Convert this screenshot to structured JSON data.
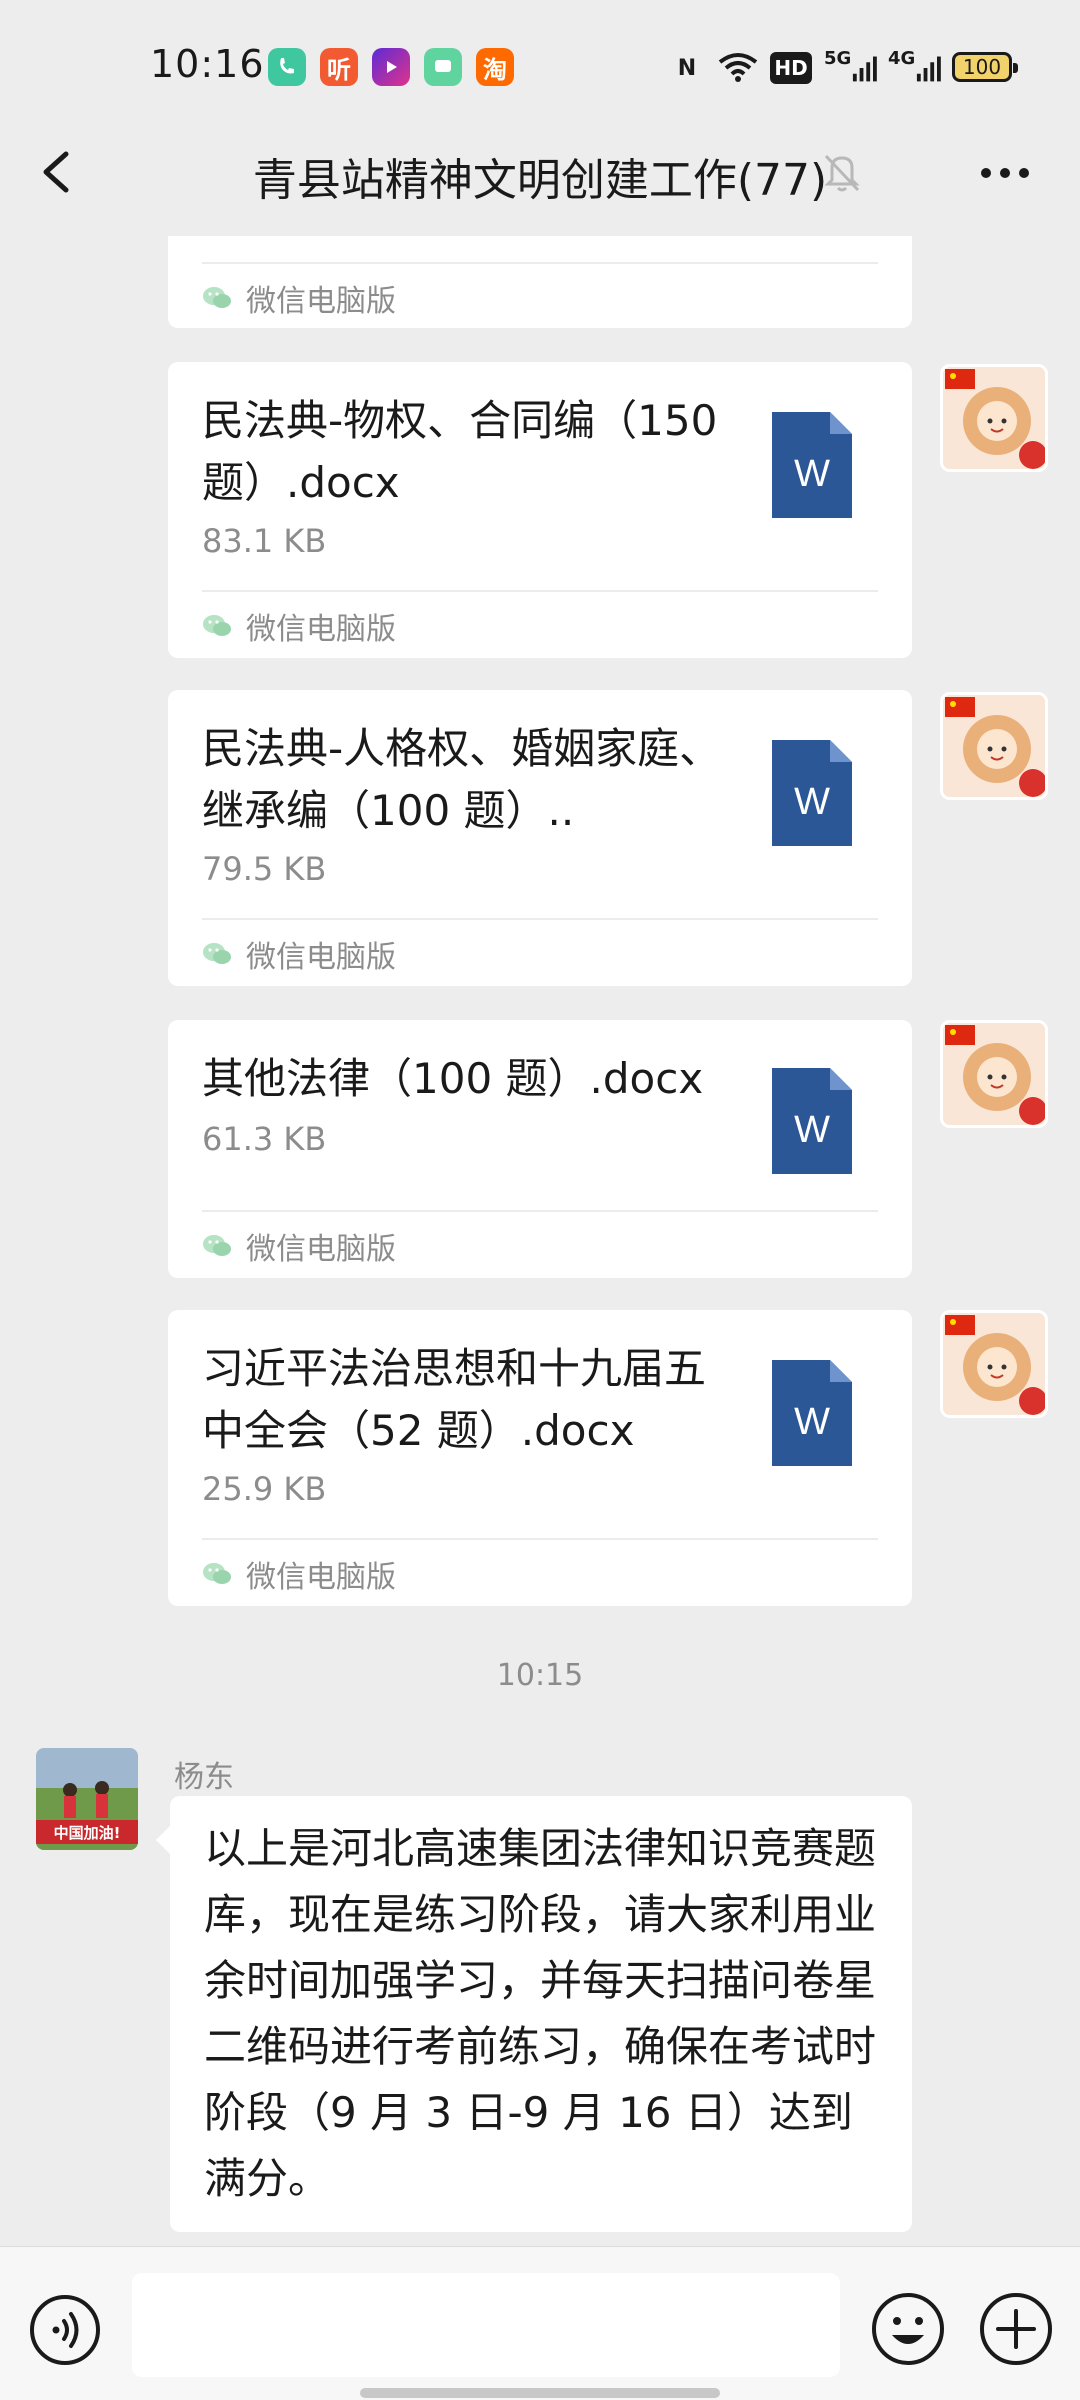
{
  "status_bar": {
    "time": "10:16",
    "app_icons": [
      "phone-app-icon",
      "ximalaya-app-icon",
      "video-app-icon",
      "message-app-icon",
      "taobao-app-icon"
    ],
    "ximalaya_glyph": "听",
    "taobao_glyph": "淘",
    "nfc_glyph": "N",
    "hd_label": "HD",
    "network_5g": "5G",
    "network_4g": "4G",
    "battery": "100"
  },
  "header": {
    "title": "青县站精神文明创建工作(77)"
  },
  "messages": {
    "partial": {
      "source": "微信电脑版"
    },
    "files": [
      {
        "name": "民法典-物权、合同编（150 题）.docx",
        "size": "83.1 KB",
        "source": "微信电脑版",
        "icon_letter": "W"
      },
      {
        "name": "民法典-人格权、婚姻家庭、继承编（100 题）..",
        "size": "79.5 KB",
        "source": "微信电脑版",
        "icon_letter": "W"
      },
      {
        "name": "其他法律（100 题）.docx",
        "size": "61.3 KB",
        "source": "微信电脑版",
        "icon_letter": "W"
      },
      {
        "name": "习近平法治思想和十九届五中全会（52 题）.docx",
        "size": "25.9 KB",
        "source": "微信电脑版",
        "icon_letter": "W"
      }
    ],
    "timestamp": "10:15",
    "text_message": {
      "sender": "杨东",
      "avatar_caption": "中国加油!",
      "text": "以上是河北高速集团法律知识竞赛题库，现在是练习阶段，请大家利用业余时间加强学习，并每天扫描问卷星二维码进行考前练习，确保在考试时阶段（9 月 3 日-9 月 16 日）达到满分。"
    }
  },
  "colors": {
    "background": "#ededed",
    "bubble": "#ffffff",
    "word_blue": "#2b5796",
    "secondary_text": "#8c8c8c",
    "wechat_green": "#07c160"
  }
}
